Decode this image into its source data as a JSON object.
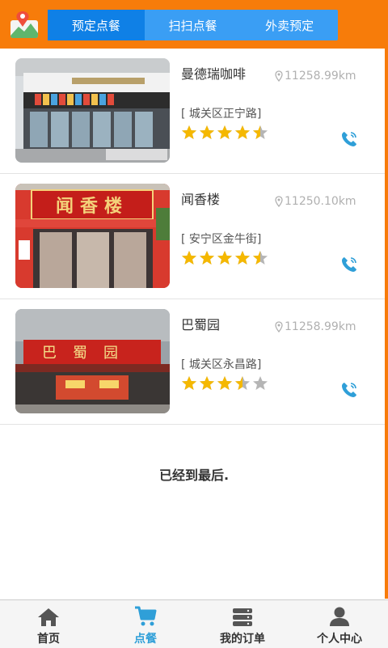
{
  "header": {
    "tabs": [
      {
        "label": "预定点餐",
        "active": true
      },
      {
        "label": "扫扫点餐",
        "active": false
      },
      {
        "label": "外卖预定",
        "active": false
      }
    ]
  },
  "restaurants": [
    {
      "name": "曼德瑞咖啡",
      "distance": "11258.99km",
      "address": "[ 城关区正宁路]",
      "rating": 4.5
    },
    {
      "name": "闻香楼",
      "distance": "11250.10km",
      "address": "[ 安宁区金牛街]",
      "rating": 4.5,
      "sign_text": "闻香楼"
    },
    {
      "name": "巴蜀园",
      "distance": "11258.99km",
      "address": "[ 城关区永昌路]",
      "rating": 3.5,
      "sign_text": "巴蜀园"
    }
  ],
  "footer_text": "已经到最后.",
  "bottom_nav": [
    {
      "label": "首页",
      "icon": "home-icon",
      "active": false
    },
    {
      "label": "点餐",
      "icon": "cart-icon",
      "active": true
    },
    {
      "label": "我的订单",
      "icon": "orders-icon",
      "active": false
    },
    {
      "label": "个人中心",
      "icon": "user-icon",
      "active": false
    }
  ],
  "colors": {
    "header": "#f77c0a",
    "tab_bg": "#3a9ef4",
    "tab_active": "#0f80e6",
    "star": "#f5b800",
    "star_empty": "#b5b5b5",
    "nav_active": "#2f9fd8"
  }
}
